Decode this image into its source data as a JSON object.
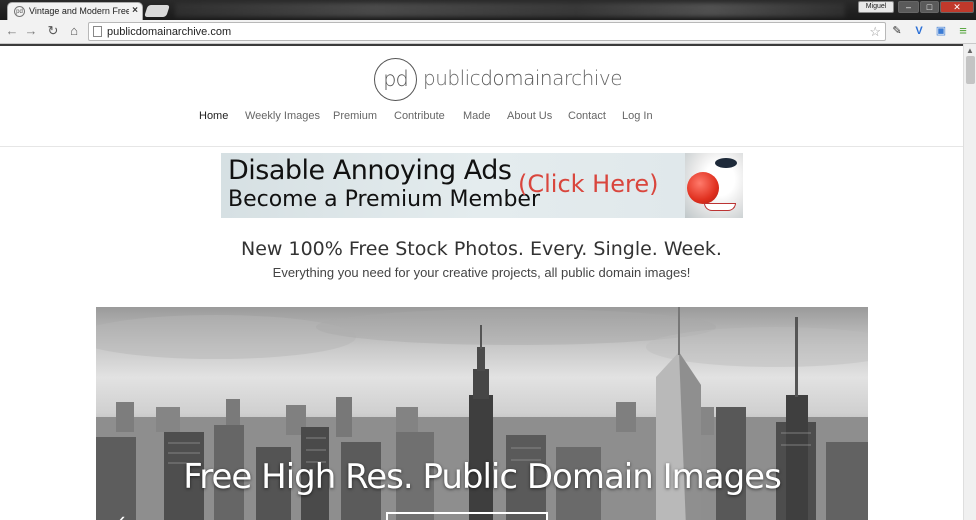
{
  "browser": {
    "tab_title": "Vintage and Modern Free",
    "tab_close": "×",
    "favicon_text": "pd",
    "user_name": "Miguel",
    "url": "publicdomainarchive.com",
    "window_buttons": {
      "minimize": "–",
      "maximize": "□",
      "close": "✕"
    }
  },
  "icons": {
    "back": "←",
    "forward": "→",
    "reload": "↻",
    "home": "⌂",
    "star": "☆",
    "ext1": "✎",
    "ext2": "V",
    "ext3": "▣",
    "menu": "≡",
    "scroll_up": "▲",
    "prev": "‹"
  },
  "site": {
    "logo_mark": "pd",
    "logo_text_public": "public",
    "logo_text_domain": "domain",
    "logo_text_archive": "archive",
    "nav": [
      "Home",
      "Weekly Images",
      "Premium",
      "Contribute",
      "Made",
      "About Us",
      "Contact",
      "Log In"
    ],
    "active_nav": "Home"
  },
  "ad": {
    "line1": "Disable Annoying Ads",
    "line2": "Become a Premium Member",
    "cta": "(Click Here)"
  },
  "headline": "New 100% Free Stock Photos. Every. Single. Week.",
  "subheadline": "Everything you need for your creative projects, all public domain images!",
  "hero": {
    "title": "Free High Res. Public Domain Images"
  },
  "colors": {
    "accent_red": "#d9463d",
    "nav_text": "#666666",
    "close_button": "#c0392b"
  }
}
